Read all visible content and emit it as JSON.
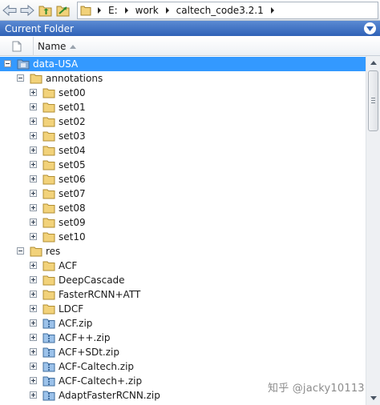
{
  "toolbar": {
    "breadcrumb": [
      "E:",
      "work",
      "caltech_code3.2.1"
    ],
    "icons": [
      "back-arrow-icon",
      "forward-arrow-icon",
      "up-folder-icon",
      "browse-folder-icon",
      "folder-icon",
      "chevron-right-icon"
    ]
  },
  "panel": {
    "title": "Current Folder",
    "menu_icon": "chevron-down-circle-icon"
  },
  "columns": {
    "name": "Name",
    "sort": "ascending"
  },
  "tree": {
    "root": {
      "label": "data-USA",
      "selected": true,
      "expanded": true
    },
    "annotations": {
      "label": "annotations",
      "expanded": true,
      "children": [
        "set00",
        "set01",
        "set02",
        "set03",
        "set04",
        "set05",
        "set06",
        "set07",
        "set08",
        "set09",
        "set10"
      ]
    },
    "res": {
      "label": "res",
      "expanded": true,
      "folders": [
        "ACF",
        "DeepCascade",
        "FasterRCNN+ATT",
        "LDCF"
      ],
      "zips": [
        "ACF.zip",
        "ACF++.zip",
        "ACF+SDt.zip",
        "ACF-Caltech.zip",
        "ACF-Caltech+.zip",
        "AdaptFasterRCNN.zip"
      ]
    }
  },
  "watermark": "知乎 @jacky10113",
  "colors": {
    "selection": "#3399ff",
    "title_bar": "#2f62b7",
    "folder": "#f2d27a",
    "zip": "#6aa0d8"
  }
}
